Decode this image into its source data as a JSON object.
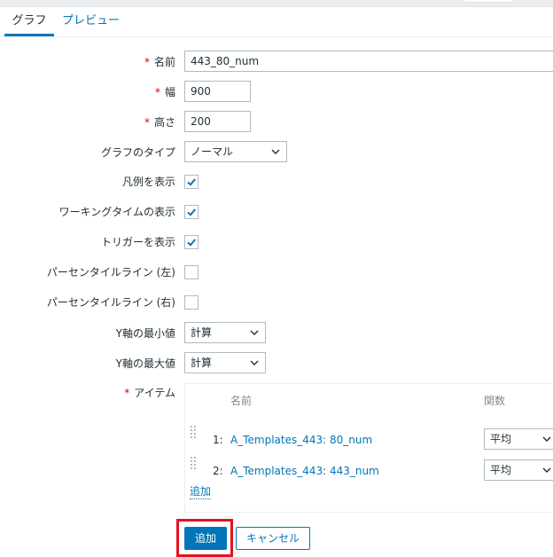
{
  "tabs": {
    "graph": "グラフ",
    "preview": "プレビュー"
  },
  "form": {
    "required_mark": "*",
    "name_label": "名前",
    "name_value": "443_80_num",
    "width_label": "幅",
    "width_value": "900",
    "height_label": "高さ",
    "height_value": "200",
    "graph_type_label": "グラフのタイプ",
    "graph_type_value": "ノーマル",
    "show_legend_label": "凡例を表示",
    "show_legend_checked": true,
    "show_working_time_label": "ワーキングタイムの表示",
    "show_working_time_checked": true,
    "show_triggers_label": "トリガーを表示",
    "show_triggers_checked": true,
    "percentile_left_label": "パーセンタイルライン (左)",
    "percentile_left_checked": false,
    "percentile_right_label": "パーセンタイルライン (右)",
    "percentile_right_checked": false,
    "y_min_label": "Y軸の最小値",
    "y_min_value": "計算",
    "y_max_label": "Y軸の最大値",
    "y_max_value": "計算",
    "items_label": "アイテム"
  },
  "items": {
    "header_name": "名前",
    "header_function": "関数",
    "rows": [
      {
        "index": "1:",
        "name": "A_Templates_443: 80_num",
        "function": "平均"
      },
      {
        "index": "2:",
        "name": "A_Templates_443: 443_num",
        "function": "平均"
      }
    ],
    "add_link": "追加"
  },
  "buttons": {
    "add": "追加",
    "cancel": "キャンセル"
  },
  "colors": {
    "accent": "#0275b8",
    "required": "#d40000",
    "highlight": "#e0141e"
  }
}
